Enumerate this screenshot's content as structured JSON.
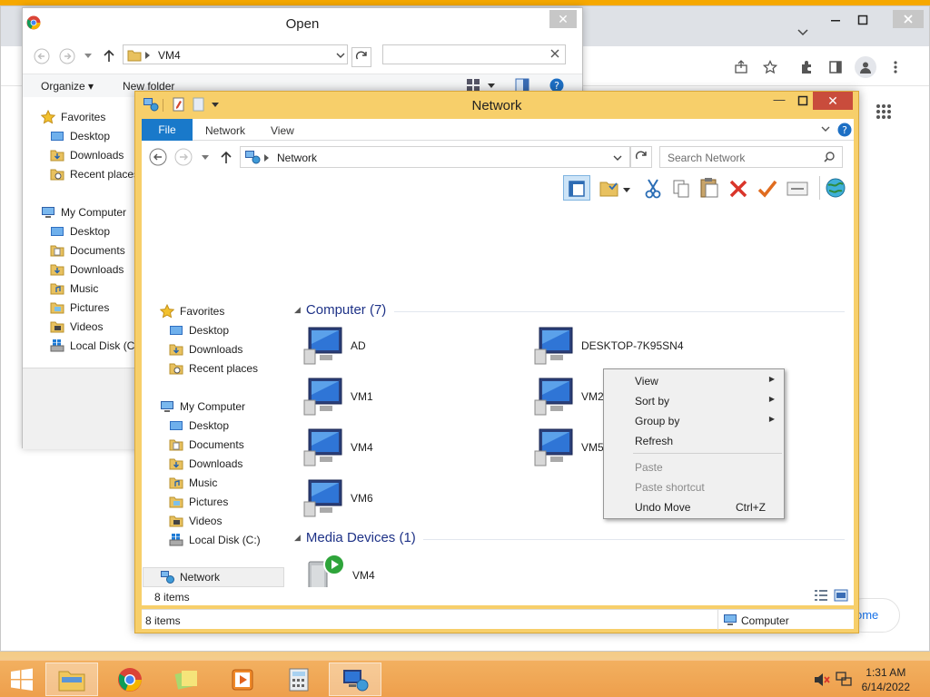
{
  "open_dialog": {
    "title": "Open",
    "address": "VM4",
    "toolbar": {
      "organize": "Organize",
      "new_folder": "New folder"
    },
    "nav": {
      "favorites_label": "Favorites",
      "favorites": [
        "Desktop",
        "Downloads",
        "Recent places"
      ],
      "computer_label": "My Computer",
      "computer": [
        "Desktop",
        "Documents",
        "Downloads",
        "Music",
        "Pictures",
        "Videos",
        "Local Disk (C:"
      ]
    }
  },
  "explorer": {
    "title": "Network",
    "ribbon": {
      "file": "File",
      "tabs": [
        "Network",
        "View"
      ]
    },
    "address": "Network",
    "search_placeholder": "Search Network",
    "nav": {
      "favorites_label": "Favorites",
      "favorites": [
        "Desktop",
        "Downloads",
        "Recent places"
      ],
      "computer_label": "My Computer",
      "computer": [
        "Desktop",
        "Documents",
        "Downloads",
        "Music",
        "Pictures",
        "Videos",
        "Local Disk (C:)"
      ],
      "network_label": "Network"
    },
    "groups": {
      "computer_header": "Computer (7)",
      "computers": [
        "AD",
        "DESKTOP-7K95SN4",
        "VM1",
        "VM2",
        "VM4",
        "VM5",
        "VM6"
      ],
      "media_header": "Media Devices (1)",
      "media": [
        "VM4"
      ]
    },
    "status_items_inner": "8 items",
    "status_items": "8 items",
    "status_location": "Computer"
  },
  "context_menu": {
    "view": "View",
    "sort_by": "Sort by",
    "group_by": "Group by",
    "refresh": "Refresh",
    "paste": "Paste",
    "paste_shortcut": "Paste shortcut",
    "undo_move": "Undo Move",
    "undo_shortcut": "Ctrl+Z"
  },
  "chrome": {
    "partial_button": "ome"
  },
  "taskbar": {
    "time": "1:31 AM",
    "date": "6/14/2022"
  },
  "colors": {
    "window_frame": "#f7cf6a",
    "file_tab": "#1979ca",
    "close": "#c94c3c",
    "group_header": "#1e3287"
  }
}
